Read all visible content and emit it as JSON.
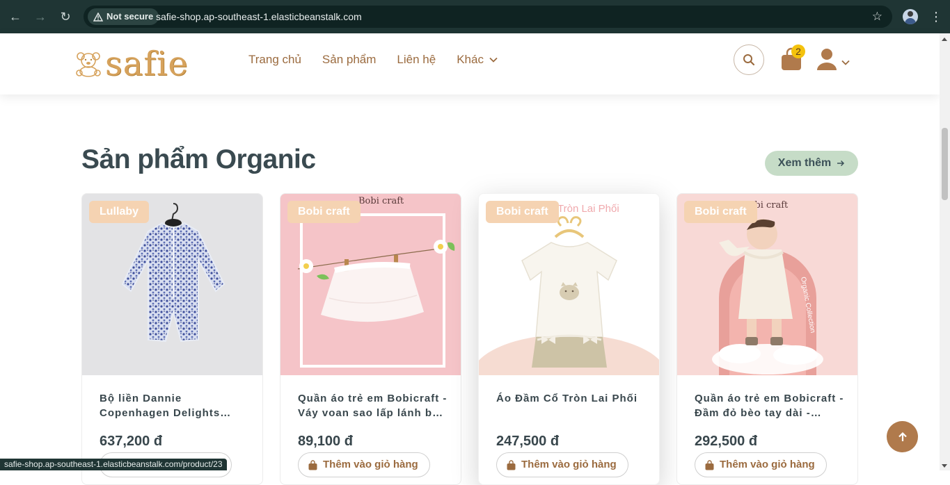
{
  "browser": {
    "security_label": "Not secure",
    "url": "safie-shop.ap-southeast-1.elasticbeanstalk.com",
    "status_url": "safie-shop.ap-southeast-1.elasticbeanstalk.com/product/23"
  },
  "header": {
    "logo_text": "safie",
    "nav": [
      {
        "label": "Trang chủ"
      },
      {
        "label": "Sản phẩm"
      },
      {
        "label": "Liên hệ"
      },
      {
        "label": "Khác"
      }
    ],
    "cart_count": "2"
  },
  "section": {
    "title": "Sản phẩm Organic",
    "more_label": "Xem thêm"
  },
  "products": [
    {
      "brand": "Lullaby",
      "name": "Bộ liền Dannie Copenhagen Delights Rashguard",
      "price": "637,200 đ",
      "add_label": "Thêm vào giỏ hàng"
    },
    {
      "brand": "Bobi craft",
      "name": "Quần áo trẻ em Bobicraft - Váy voan sao lấp lánh bé gái",
      "price": "89,100 đ",
      "add_label": "Thêm vào giỏ hàng",
      "image_text": "Bobi craft"
    },
    {
      "brand": "Bobi craft",
      "name": "Áo Đầm Cổ Tròn Lai Phối",
      "price": "247,500 đ",
      "add_label": "Thêm vào giỏ hàng",
      "image_text": "Tròn Lai Phối"
    },
    {
      "brand": "Bobi craft",
      "name": "Quần áo trẻ em Bobicraft - Đầm đỏ bèo tay dài - Organic",
      "price": "292,500 đ",
      "add_label": "Thêm vào giỏ hàng",
      "image_text": "Bobi craft",
      "image_side_text": "Organic Collection"
    }
  ],
  "colors": {
    "brand_brown": "#9b6b3f",
    "badge_peach": "#f5d3b2",
    "more_green": "#c6dcc7",
    "cart_badge": "#f4c20d"
  }
}
